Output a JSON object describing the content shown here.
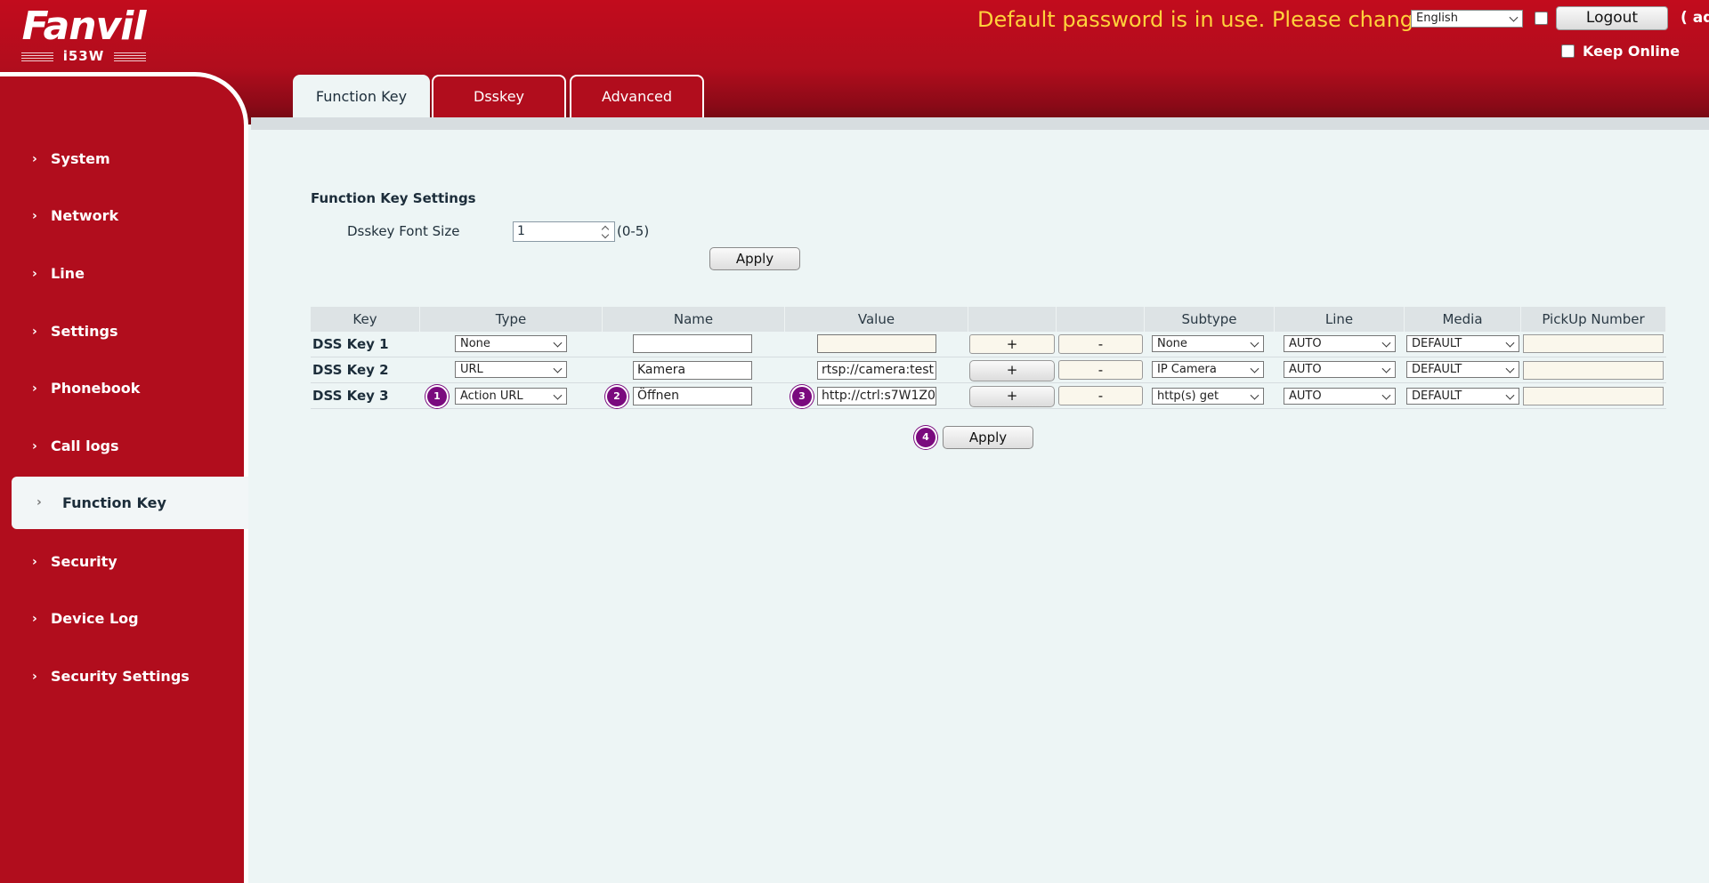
{
  "header": {
    "logo_text": "Fanvil",
    "model": "i53W",
    "warning": "Default password is in use. Please change",
    "language": "English",
    "logout": "Logout",
    "user_cut": "( ad",
    "keep_online": "Keep Online"
  },
  "sidebar": {
    "items": [
      {
        "label": "System"
      },
      {
        "label": "Network"
      },
      {
        "label": "Line"
      },
      {
        "label": "Settings"
      },
      {
        "label": "Phonebook"
      },
      {
        "label": "Call logs"
      },
      {
        "label": "Function Key",
        "active": true
      },
      {
        "label": "Security"
      },
      {
        "label": "Device Log"
      },
      {
        "label": "Security Settings"
      }
    ]
  },
  "tabs": [
    {
      "label": "Function Key",
      "active": true
    },
    {
      "label": "Dsskey"
    },
    {
      "label": "Advanced"
    }
  ],
  "settings": {
    "title": "Function Key Settings",
    "font_size_label": "Dsskey Font Size",
    "font_size_value": "1",
    "font_size_range": "(0-5)",
    "apply": "Apply"
  },
  "table": {
    "headers": [
      "Key",
      "Type",
      "Name",
      "Value",
      "",
      "",
      "Subtype",
      "Line",
      "Media",
      "PickUp Number"
    ],
    "rows": [
      {
        "key": "DSS Key 1",
        "type": "None",
        "name": "",
        "value": "",
        "plus": "+",
        "minus": "-",
        "subtype": "None",
        "line": "AUTO",
        "media": "DEFAULT",
        "pickup": ""
      },
      {
        "key": "DSS Key 2",
        "type": "URL",
        "name": "Kamera",
        "value": "rtsp://camera:test",
        "plus": "+",
        "minus": "-",
        "subtype": "IP Camera",
        "line": "AUTO",
        "media": "DEFAULT",
        "pickup": ""
      },
      {
        "key": "DSS Key 3",
        "type": "Action URL",
        "name": "Öffnen",
        "value": "http://ctrl:s7W1Z0",
        "plus": "+",
        "minus": "-",
        "subtype": "http(s) get",
        "line": "AUTO",
        "media": "DEFAULT",
        "pickup": ""
      }
    ],
    "apply": "Apply"
  },
  "annotations": [
    "1",
    "2",
    "3",
    "4"
  ],
  "colors": {
    "brand_red": "#b10d1d",
    "warning_yellow": "#ffd23b",
    "badge_purple": "#7a0a7e",
    "content_bg": "#edf5f5"
  }
}
